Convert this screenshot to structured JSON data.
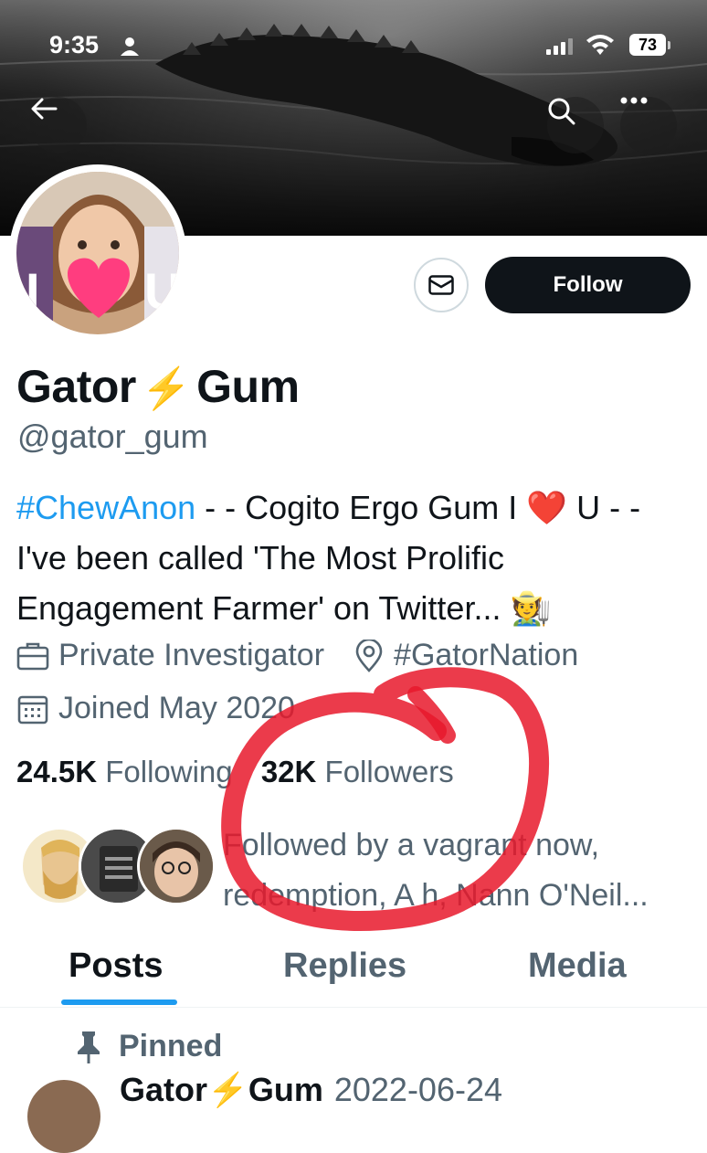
{
  "status_bar": {
    "time": "9:35",
    "battery": "73"
  },
  "profile": {
    "name_first": "Gator",
    "name_bolt": "⚡",
    "name_last": "Gum",
    "handle": "@gator_gum",
    "follow_label": "Follow",
    "bio_tag": "#ChewAnon",
    "bio_part1": " - - Cogito Ergo Gum I ",
    "bio_heart": "❤️",
    "bio_part2": " U - - I've been called 'The Most Prolific Engagement Farmer' on Twitter... ",
    "bio_emoji": "🧑‍🌾",
    "profession": "Private Investigator",
    "location": "#GatorNation",
    "joined": "Joined May 2020",
    "following_count": "24.5K",
    "following_label": "Following",
    "followers_count": "32K",
    "followers_label": "Followers",
    "followed_by": "Followed by a vagrant now, redemption, A h, Nann O'Neil..."
  },
  "tabs": [
    "Posts",
    "Replies",
    "Media"
  ],
  "pinned_label": "Pinned",
  "post": {
    "name_first": "Gator",
    "bolt": "⚡",
    "name_last": "Gum",
    "date": "2022-06-24"
  },
  "colors": {
    "accent": "#1d9bf0",
    "annotation_red": "#e8192c",
    "bolt": "#f5b400"
  },
  "icons": [
    "back-arrow-icon",
    "search-icon",
    "more-icon",
    "mail-icon",
    "briefcase-icon",
    "location-pin-icon",
    "calendar-icon",
    "pin-icon"
  ]
}
